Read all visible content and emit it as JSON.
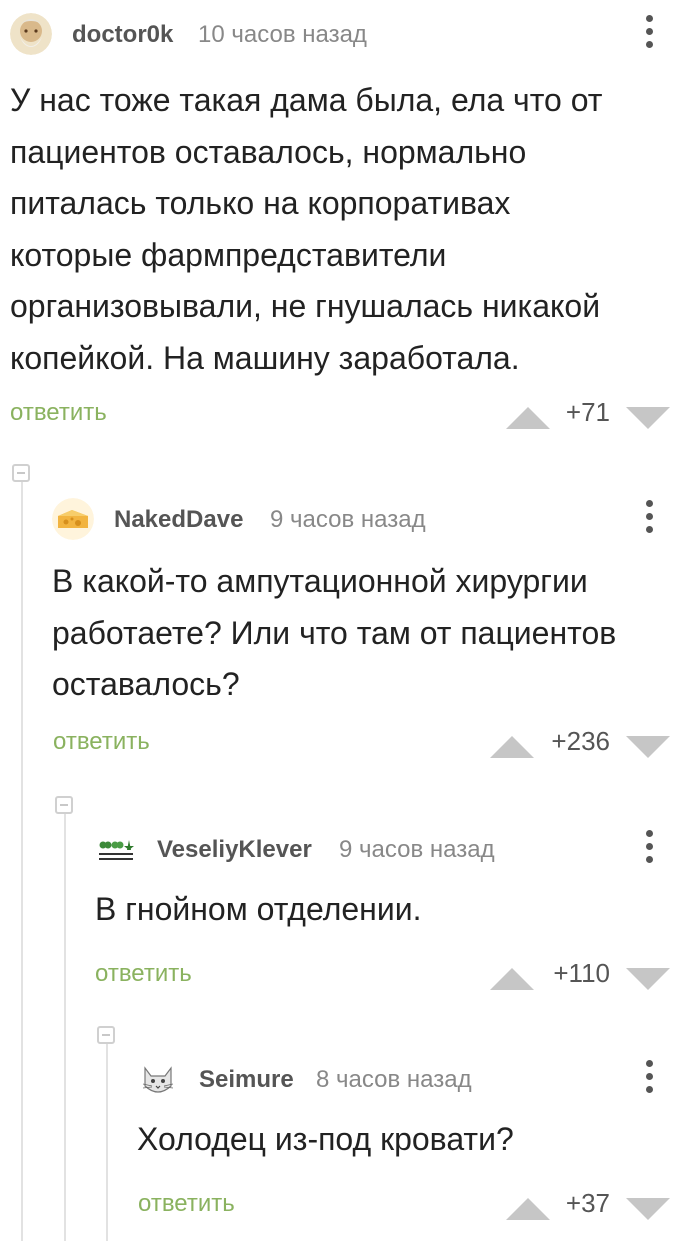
{
  "comments": [
    {
      "author": "doctor0k",
      "time": "10 часов назад",
      "text_lines": [
        "У нас тоже такая дама была, ела что от",
        "пациентов оставалось, нормально",
        "питалась только на корпоративах",
        "которые фармпредставители",
        "организовывали, не гнушалась никакой",
        "копейкой. На машину заработала."
      ],
      "reply_label": "ответить",
      "rating": "+71",
      "avatar_icon": "old-man-avatar-icon"
    },
    {
      "author": "NakedDave",
      "time": "9 часов назад",
      "text_lines": [
        "В какой-то ампутационной хирургии",
        "работаете? Или что там от пациентов",
        "оставалось?"
      ],
      "reply_label": "ответить",
      "rating": "+236",
      "avatar_icon": "cheese-avatar-icon"
    },
    {
      "author": "VeseliyKlever",
      "time": "9 часов назад",
      "text_lines": [
        "В гнойном отделении."
      ],
      "reply_label": "ответить",
      "rating": "+110",
      "avatar_icon": "clover-avatar-icon"
    },
    {
      "author": "Seimure",
      "time": "8 часов назад",
      "text_lines": [
        "Холодец из-под кровати?"
      ],
      "reply_label": "ответить",
      "rating": "+37",
      "avatar_icon": "cat-avatar-icon"
    }
  ],
  "colors": {
    "reply_link": "#8ab25f",
    "vote_arrow": "#c6c6c6",
    "thread_line": "#e2e2e2"
  }
}
